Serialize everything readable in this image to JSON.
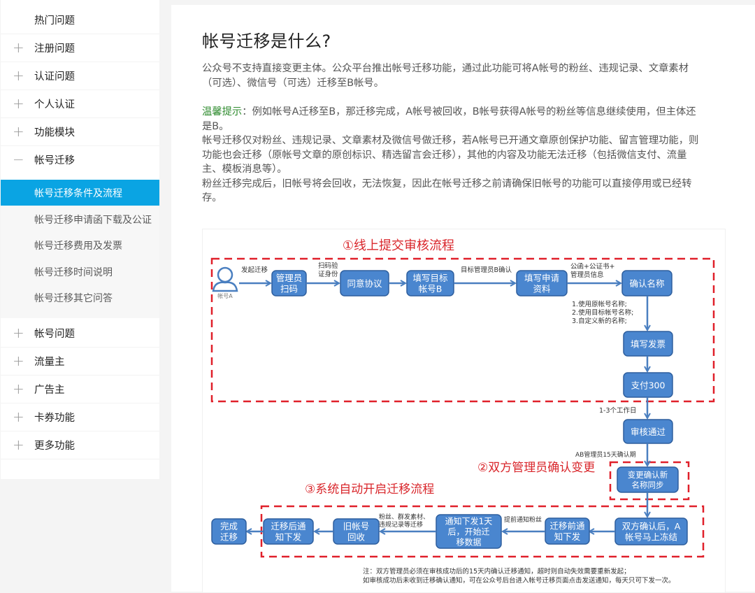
{
  "sidebar": {
    "items": [
      {
        "label": "热门问题",
        "sign": ""
      },
      {
        "label": "注册问题",
        "sign": "+"
      },
      {
        "label": "认证问题",
        "sign": "+"
      },
      {
        "label": "个人认证",
        "sign": "+"
      },
      {
        "label": "功能模块",
        "sign": "+"
      },
      {
        "label": "帐号迁移",
        "sign": "−"
      }
    ],
    "subitems": [
      {
        "label": "帐号迁移条件及流程",
        "active": true
      },
      {
        "label": "帐号迁移申请函下载及公证"
      },
      {
        "label": "帐号迁移费用及发票"
      },
      {
        "label": "帐号迁移时间说明"
      },
      {
        "label": "帐号迁移其它问答"
      }
    ],
    "items_after": [
      {
        "label": "帐号问题",
        "sign": "+"
      },
      {
        "label": "流量主",
        "sign": "+"
      },
      {
        "label": "广告主",
        "sign": "+"
      },
      {
        "label": "卡券功能",
        "sign": "+"
      },
      {
        "label": "更多功能",
        "sign": "+"
      }
    ]
  },
  "content": {
    "title": "帐号迁移是什么?",
    "intro_line1": "公众号不支持直接变更主体。公众平台推出帐号迁移功能，通过此功能可将A帐号的粉丝、违规记录、文章素材",
    "intro_line2": "（可选）、微信号（可选）迁移至B帐号。",
    "tip_label": "温馨提示",
    "tip_line1": "：例如帐号A迁移至B，那迁移完成，A帐号被回收，B帐号获得A帐号的粉丝等信息继续使用，但主体还",
    "tip_line2": "是B。",
    "p2_line1": "帐号迁移仅对粉丝、违规记录、文章素材及微信号做迁移，若A帐号已开通文章原创保护功能、留言管理功能，则",
    "p2_line2": "功能也会迁移（原帐号文章的原创标识、精选留言会迁移），其他的内容及功能无法迁移（包括微信支付、流量",
    "p2_line3": "主、模板消息等）。",
    "p3_line1": "粉丝迁移完成后，旧帐号将会回收，无法恢复，因此在帐号迁移之前请确保旧帐号的功能可以直接停用或已经转",
    "p3_line2": "存。"
  },
  "diagram": {
    "colors": {
      "box": "#4a86cf",
      "box_border": "#2e5f9e",
      "dash": "#e0202a",
      "arrow": "#4a7fc0",
      "heading": "#d9262b"
    },
    "stage1_title": "①线上提交审核流程",
    "stage2_title": "②双方管理员确认变更",
    "stage3_title": "③系统自动开启迁移流程",
    "user_label": "帐号A",
    "nodes": {
      "admin_scan": [
        "管理员",
        "扫码"
      ],
      "agree": [
        "同意协议"
      ],
      "fill_target": [
        "填写目标",
        "帐号B"
      ],
      "fill_apply": [
        "填写申请",
        "资料"
      ],
      "confirm_name": [
        "确认名称"
      ],
      "invoice": [
        "填写发票"
      ],
      "pay": [
        "支付300"
      ],
      "approved": [
        "审核通过"
      ],
      "change_confirm": [
        "变更确认新",
        "名称同步"
      ],
      "freeze": [
        "双方确认后，A",
        "帐号马上冻结"
      ],
      "pre_notice": [
        "迁移前通",
        "知下发"
      ],
      "start_migrate": [
        "通知下发1天",
        "后，开始迁",
        "移数据"
      ],
      "old_recycle": [
        "旧帐号",
        "回收"
      ],
      "post_notice": [
        "迁移后通",
        "知下发"
      ],
      "done": [
        "完成",
        "迁移"
      ]
    },
    "edge_labels": {
      "initiate": "发起迁移",
      "scan_verify": [
        "扫码验",
        "证身份"
      ],
      "target_confirm": "目标管理员B确认",
      "docs": [
        "公函+公证书+",
        "管理员信息"
      ],
      "name_options": [
        "1.使用原帐号名称;",
        "2.使用目标帐号名称;",
        "3.自定义新的名称;"
      ],
      "workdays": "1-3个工作日",
      "confirm_period": "AB管理员15天确认期",
      "notify_fans": "提前通知粉丝",
      "migrate_items": [
        "粉丝、群发素材、",
        "违规记录等迁移"
      ]
    },
    "note_line1": "注：双方管理员必须在审核成功后的15天内确认迁移通知，超时则自动失效需要重新发起；",
    "note_line2": "如审核成功后未收到迁移确认通知，可在公众号后台进入帐号迁移页面点击发送通知，每天只可下发一次。"
  }
}
